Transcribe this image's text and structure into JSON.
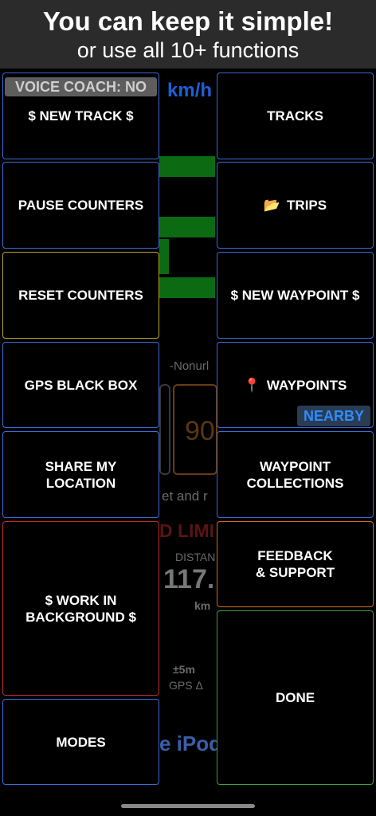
{
  "banner": {
    "title": "You can keep it simple!",
    "subtitle": "or use all 10+ functions"
  },
  "background": {
    "speed_unit": "km/h",
    "profile_text": "-Nonurl",
    "speed_value": "90",
    "hint_text": "et and r",
    "limit_text": "D LIMI",
    "distance_label": "DISTAN",
    "distance_value": "117.",
    "distance_unit": "km",
    "gps_value": "±5m",
    "gps_label": "GPS Δ",
    "device_text": "e iPod"
  },
  "badges": {
    "voice_coach": "VOICE COACH: NO",
    "nearby": "NEARBY"
  },
  "menu": {
    "new_track": "$ NEW TRACK $",
    "tracks": "TRACKS",
    "pause_counters": "PAUSE COUNTERS",
    "trips": "TRIPS",
    "trips_icon": "📂",
    "reset_counters": "RESET COUNTERS",
    "new_waypoint": "$ NEW WAYPOINT $",
    "gps_black_box": "GPS BLACK BOX",
    "waypoints": "WAYPOINTS",
    "waypoints_icon": "📍",
    "share_location": "SHARE MY\nLOCATION",
    "waypoint_collections": "WAYPOINT\nCOLLECTIONS",
    "work_in_background": "$ WORK IN\nBACKGROUND $",
    "feedback_support": "FEEDBACK\n& SUPPORT",
    "modes": "MODES",
    "done": "DONE"
  },
  "colors": {
    "default_border": "#3a6bd6",
    "yellow_border": "#b5a528",
    "red_border": "#c22a2a",
    "orange_border": "#d26b1e",
    "green_border": "#3aa33a",
    "nearby_text": "#2f8cff"
  }
}
